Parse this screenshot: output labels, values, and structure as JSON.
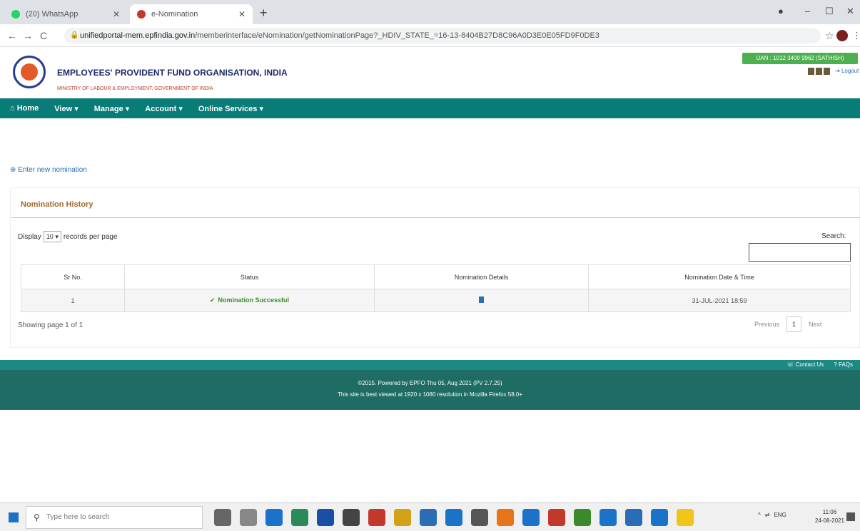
{
  "browser": {
    "tabs": [
      {
        "title": "(20) WhatsApp",
        "favicon_color": "#25d366"
      },
      {
        "title": "e-Nomination",
        "favicon_color": "#c0392b"
      }
    ],
    "url_host": "unifiedportal-mem.epfindia.gov.in",
    "url_path": "/memberinterface/eNomination/getNominationPage?_HDIV_STATE_=16-13-8404B27D8C96A0D3E0E05FD9F0DE3"
  },
  "header": {
    "org_name": "EMPLOYEES' PROVIDENT FUND ORGANISATION, INDIA",
    "ministry": "MINISTRY OF LABOUR & EMPLOYMENT, GOVERNMENT OF INDIA",
    "uan_badge": "UAN : 1012 3400 9962 (SATHISH)",
    "logout": "Logout"
  },
  "nav": {
    "home": "Home",
    "view": "View ▾",
    "manage": "Manage ▾",
    "account": "Account ▾",
    "online": "Online Services ▾"
  },
  "content": {
    "enter_link": "Enter new nomination",
    "panel_title": "Nomination History",
    "display_prefix": "Display",
    "display_value": "10",
    "display_suffix": "records per page",
    "search_label": "Search:",
    "columns": [
      "Sr No.",
      "Status",
      "Nomination Details",
      "Nomination Date & Time"
    ],
    "row": {
      "sr": "1",
      "status": "Nomination Successful",
      "date": "31-JUL-2021 18:59"
    },
    "showing": "Showing page 1 of 1",
    "pager": {
      "previous": "Previous",
      "page": "1",
      "next": "Next"
    }
  },
  "footer": {
    "contact": "Contact Us",
    "faqs": "FAQs",
    "line1": "©2015. Powered by EPFO Thu 05, Aug 2021 (PV 2.7.25)",
    "line2": "This site is best viewed at 1920 x 1080 resolution in Mozilla Firefox 58.0+"
  },
  "taskbar": {
    "search_placeholder": "Type here to search",
    "lang": "ENG",
    "time": "11:06",
    "date": "24-08-2021",
    "icon_colors": [
      "#666",
      "#888",
      "#1a73c8",
      "#2a8a5a",
      "#1a4fa8",
      "#444",
      "#c0392b",
      "#d4a017",
      "#2a6db5",
      "#1a73c8",
      "#555",
      "#e8741a",
      "#1a73c8",
      "#c0392b",
      "#3a8a2c",
      "#1a73c8",
      "#2a6db5",
      "#1a73c8",
      "#f0c419"
    ]
  },
  "colors": {
    "nav_teal": "#0a7c77",
    "footer_teal": "#1e6c64",
    "panel_title": "#a06a2c",
    "success_green": "#3a8a2c"
  }
}
